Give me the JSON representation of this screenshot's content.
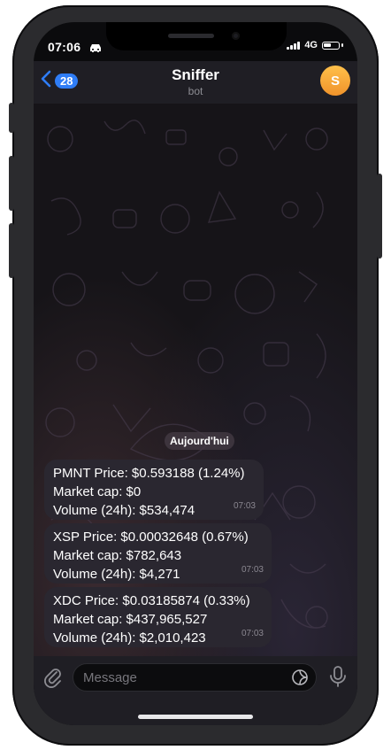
{
  "status_bar": {
    "time": "07:06",
    "network": "4G"
  },
  "header": {
    "back_count": "28",
    "title": "Sniffer",
    "subtitle": "bot",
    "avatar_initial": "S"
  },
  "chat": {
    "date_label": "Aujourd'hui",
    "messages": [
      {
        "lines": [
          "PMNT Price: $0.593188 (1.24%)",
          "Market cap: $0",
          "Volume (24h): $534,474"
        ],
        "time": "07:03"
      },
      {
        "lines": [
          "XSP Price: $0.00032648 (0.67%)",
          "Market cap: $782,643",
          "Volume (24h): $4,271"
        ],
        "time": "07:03"
      },
      {
        "lines": [
          "XDC Price: $0.03185874 (0.33%)",
          "Market cap: $437,965,527",
          "Volume (24h): $2,010,423"
        ],
        "time": "07:03"
      }
    ]
  },
  "input": {
    "placeholder": "Message"
  },
  "icons": {
    "attach": "paperclip-icon",
    "sticker": "sticker-icon",
    "mic": "microphone-icon",
    "back": "chevron-left-icon"
  },
  "colors": {
    "accent": "#2f7df6",
    "avatar": "#f5a73a",
    "bubble": "#2a2730"
  }
}
